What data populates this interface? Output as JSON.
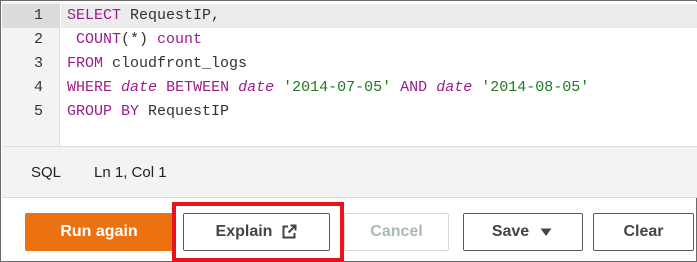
{
  "editor": {
    "line_numbers": [
      "1",
      "2",
      "3",
      "4",
      "5"
    ],
    "lines": [
      [
        {
          "t": "SELECT",
          "c": "kw"
        },
        {
          "t": " RequestIP,",
          "c": "id"
        }
      ],
      [
        {
          "t": " ",
          "c": "id"
        },
        {
          "t": "COUNT",
          "c": "fn"
        },
        {
          "t": "(*) ",
          "c": "id"
        },
        {
          "t": "count",
          "c": "kw"
        }
      ],
      [
        {
          "t": "FROM",
          "c": "kw"
        },
        {
          "t": " cloudfront_logs",
          "c": "id"
        }
      ],
      [
        {
          "t": "WHERE",
          "c": "kw"
        },
        {
          "t": " ",
          "c": "id"
        },
        {
          "t": "date",
          "c": "dt"
        },
        {
          "t": " ",
          "c": "id"
        },
        {
          "t": "BETWEEN",
          "c": "kw"
        },
        {
          "t": " ",
          "c": "id"
        },
        {
          "t": "date",
          "c": "dt"
        },
        {
          "t": " ",
          "c": "id"
        },
        {
          "t": "'2014-07-05'",
          "c": "str"
        },
        {
          "t": " ",
          "c": "id"
        },
        {
          "t": "AND",
          "c": "kw"
        },
        {
          "t": " ",
          "c": "id"
        },
        {
          "t": "date",
          "c": "dt"
        },
        {
          "t": " ",
          "c": "id"
        },
        {
          "t": "'2014-08-05'",
          "c": "str"
        }
      ],
      [
        {
          "t": "GROUP BY",
          "c": "kw"
        },
        {
          "t": " RequestIP",
          "c": "id"
        }
      ]
    ]
  },
  "status": {
    "language": "SQL",
    "cursor": "Ln 1, Col 1"
  },
  "buttons": {
    "run": "Run again",
    "explain": "Explain",
    "cancel": "Cancel",
    "save": "Save",
    "clear": "Clear"
  },
  "colors": {
    "primary": "#ec7211",
    "highlight": "#e8141c"
  }
}
